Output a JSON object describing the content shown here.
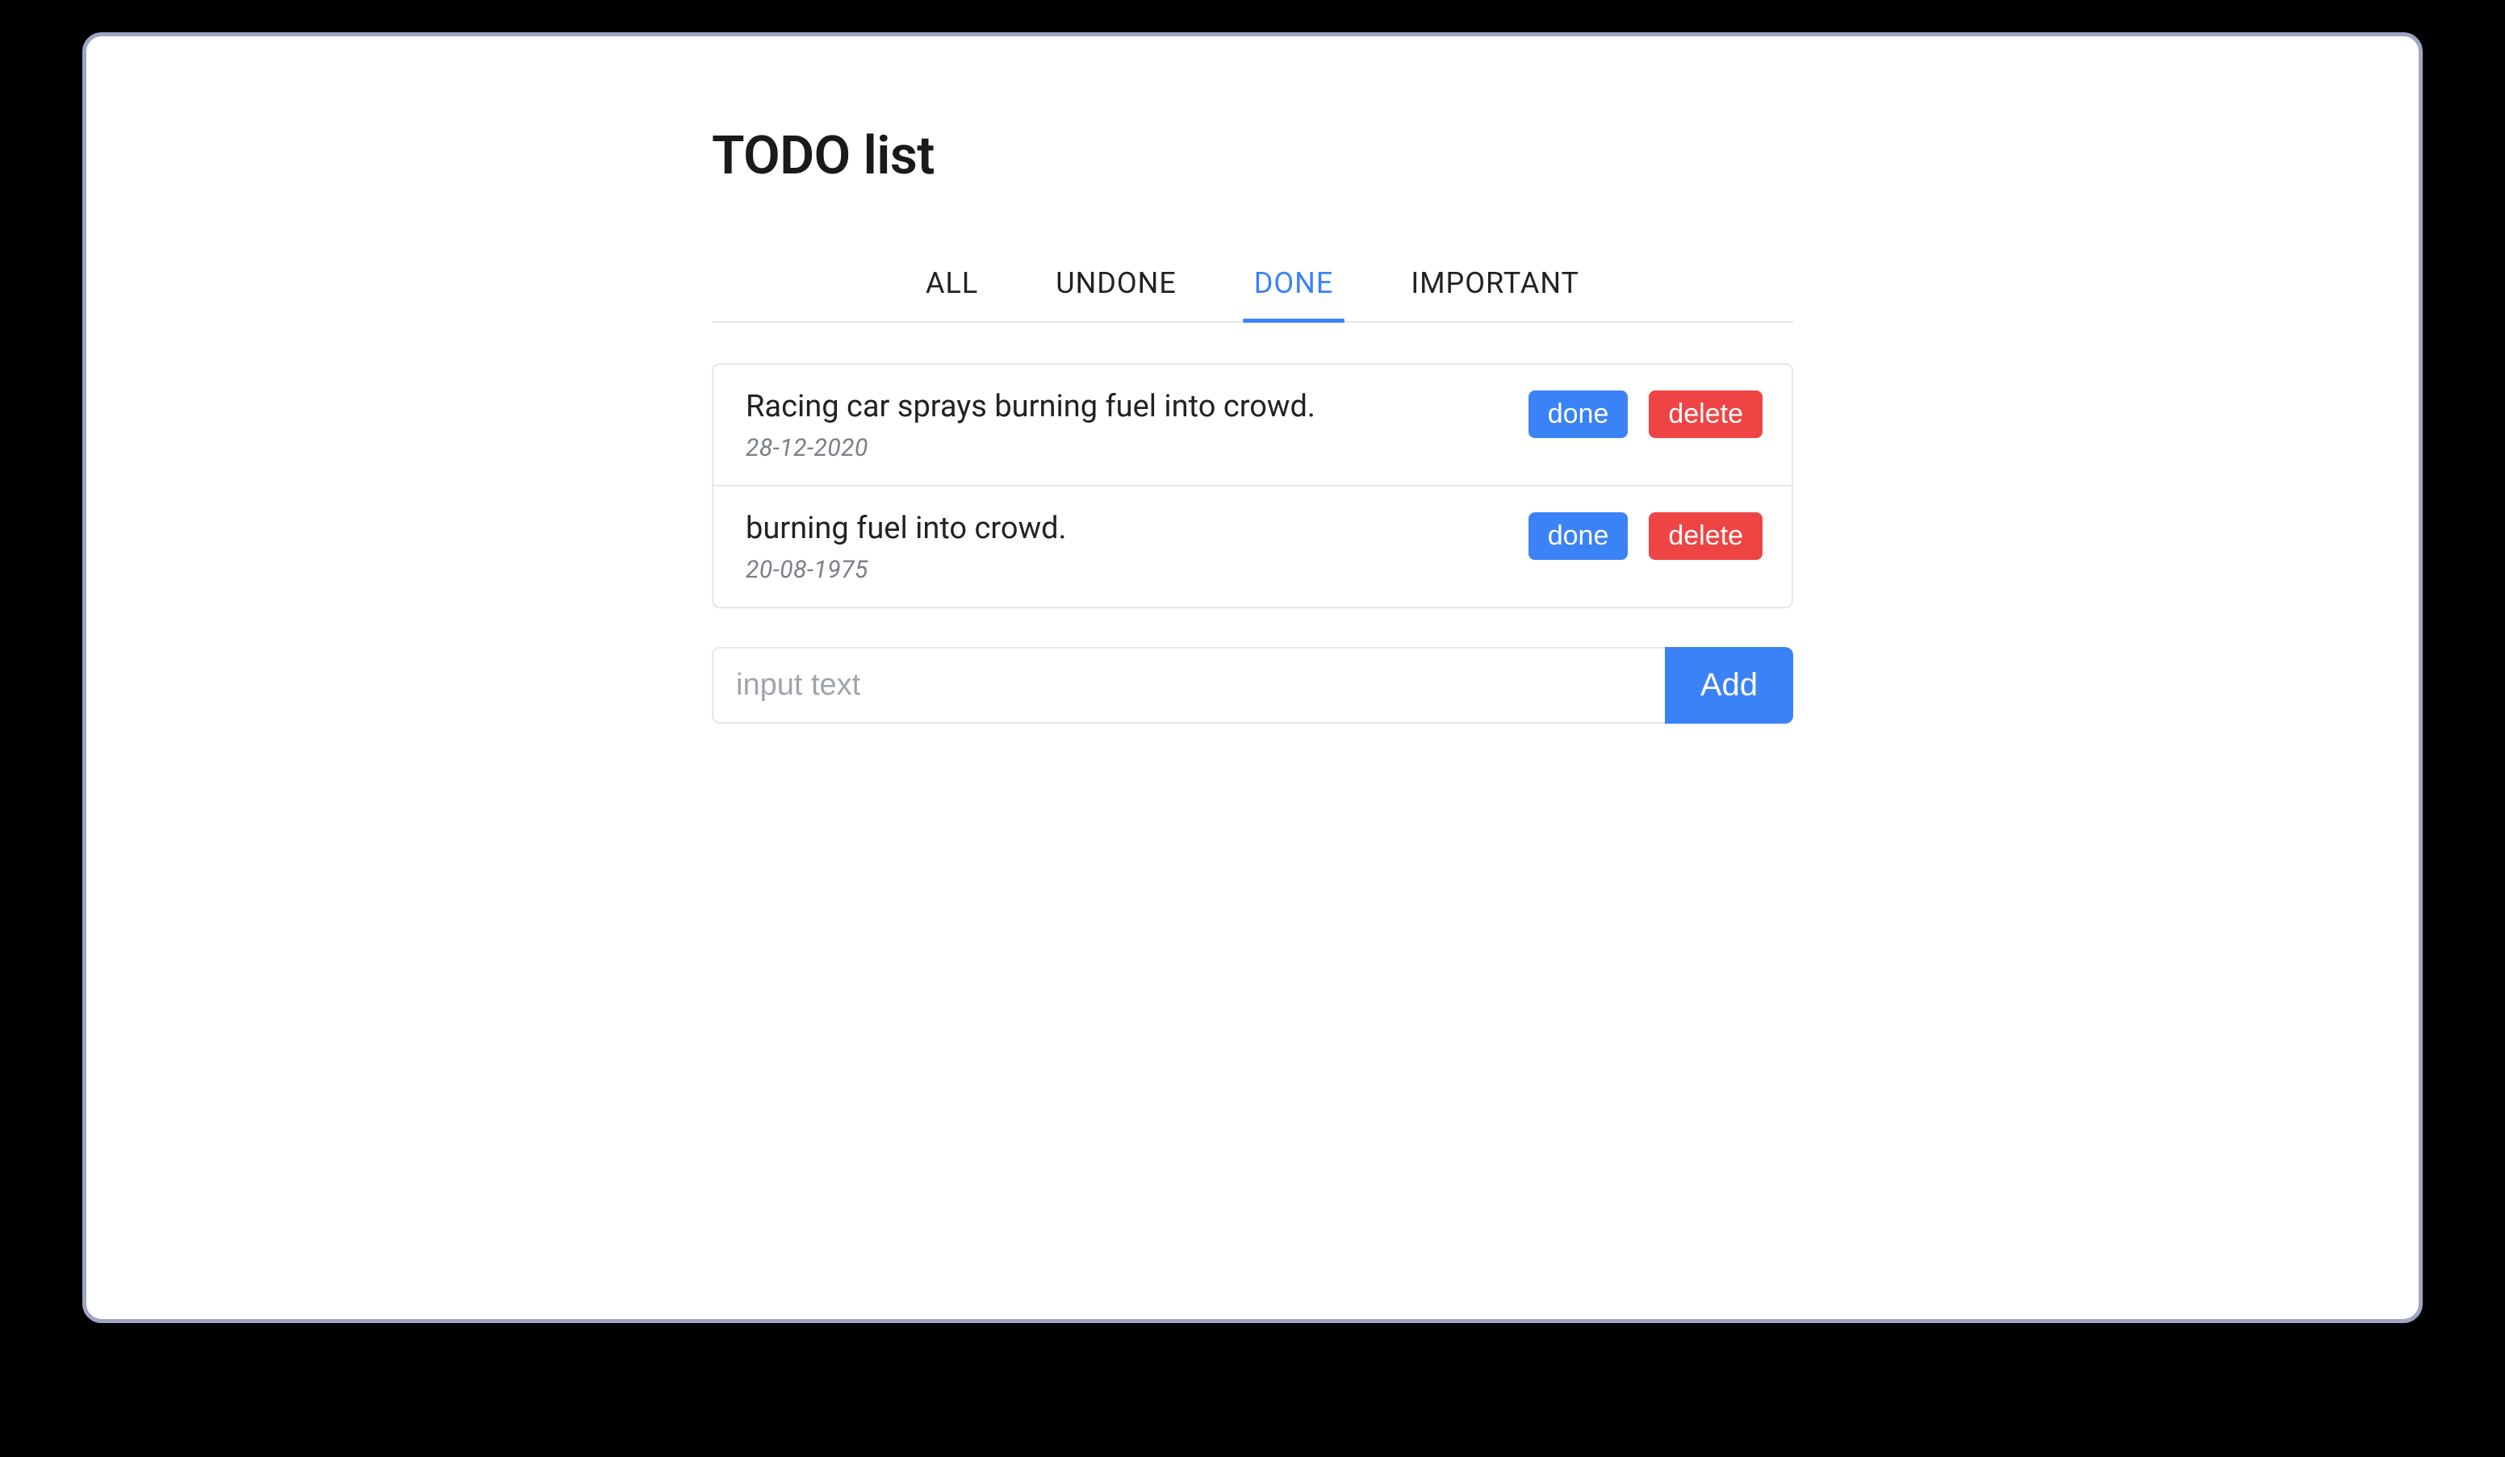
{
  "header": {
    "title": "TODO list"
  },
  "tabs": {
    "items": [
      {
        "label": "ALL",
        "active": false
      },
      {
        "label": "UNDONE",
        "active": false
      },
      {
        "label": "DONE",
        "active": true
      },
      {
        "label": "IMPORTANT",
        "active": false
      }
    ]
  },
  "todos": [
    {
      "text": "Racing car sprays burning fuel into crowd.",
      "date": "28-12-2020",
      "done_label": "done",
      "delete_label": "delete"
    },
    {
      "text": "burning fuel into crowd.",
      "date": "20-08-1975",
      "done_label": "done",
      "delete_label": "delete"
    }
  ],
  "input": {
    "placeholder": "input text",
    "add_label": "Add"
  },
  "colors": {
    "accent": "#3b82f6",
    "danger": "#ef4444",
    "border": "#e5e7eb",
    "muted": "#7a7f87"
  }
}
